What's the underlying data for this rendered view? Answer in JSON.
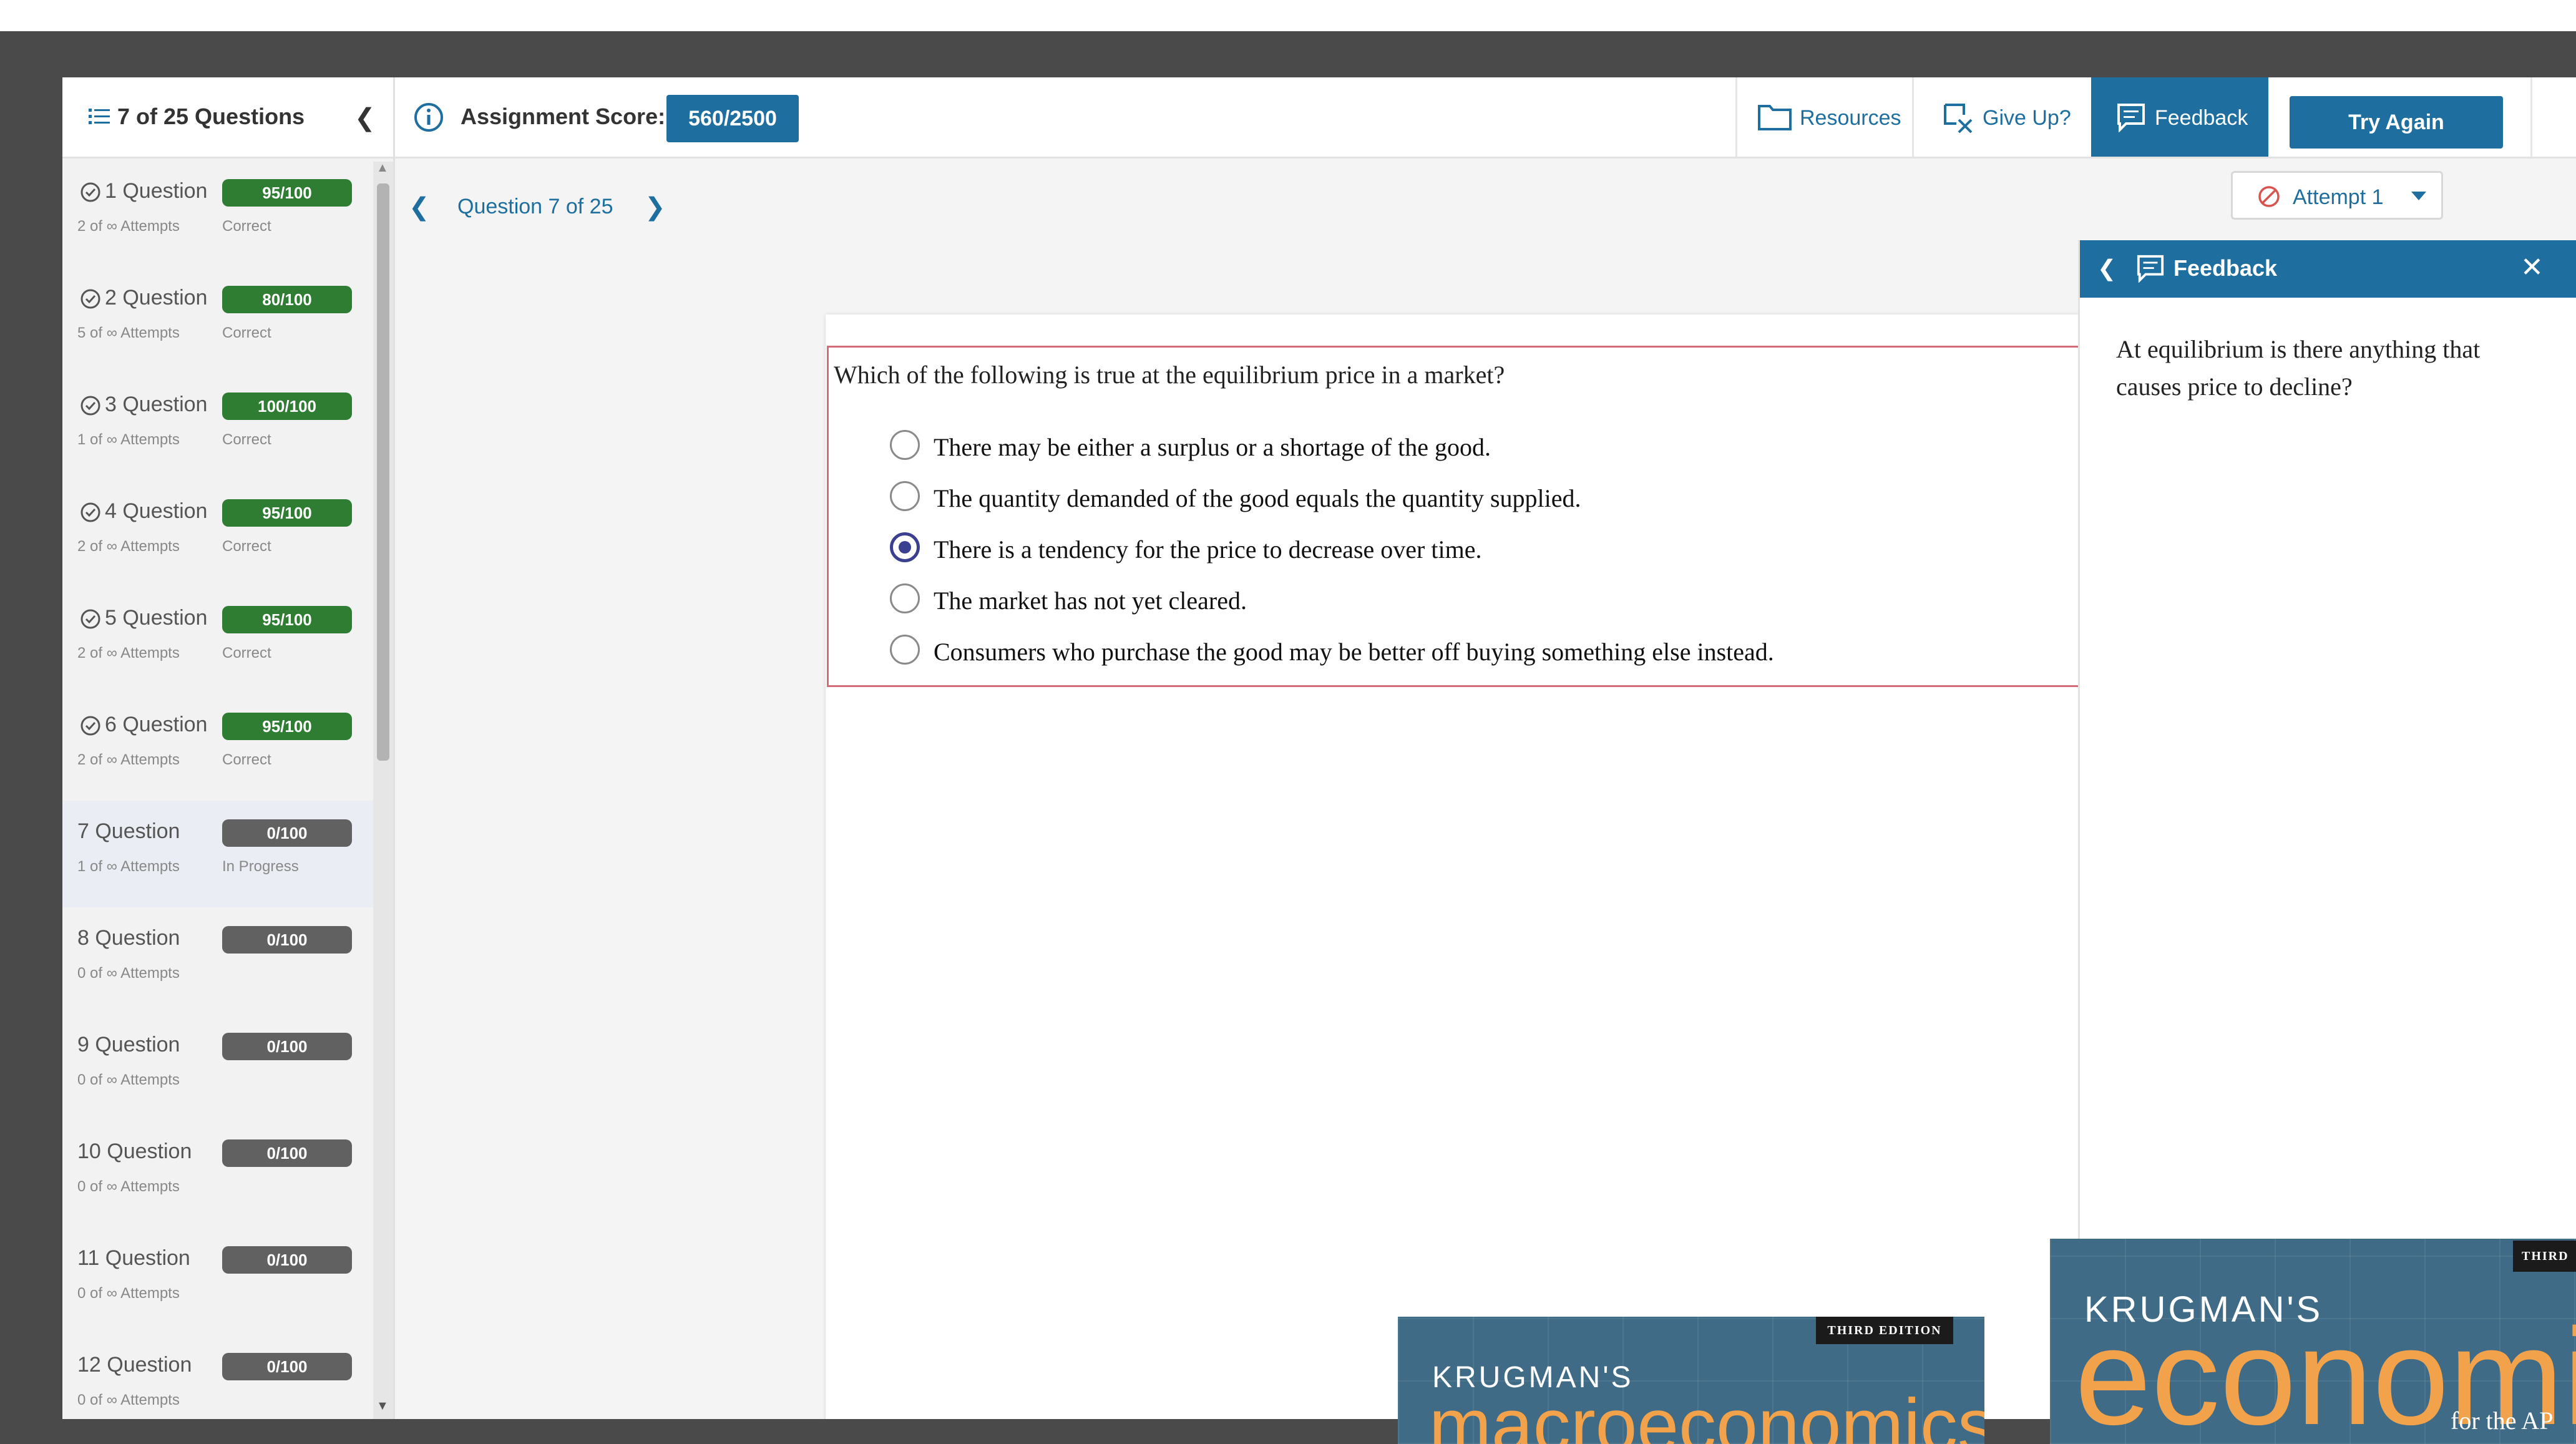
{
  "sidebar": {
    "title": "7 of 25 Questions",
    "items": [
      {
        "label": "1 Question",
        "attempts": "2 of ∞ Attempts",
        "status": "Correct",
        "score": "95/100",
        "answered": true
      },
      {
        "label": "2 Question",
        "attempts": "5 of ∞ Attempts",
        "status": "Correct",
        "score": "80/100",
        "answered": true
      },
      {
        "label": "3 Question",
        "attempts": "1 of ∞ Attempts",
        "status": "Correct",
        "score": "100/100",
        "answered": true
      },
      {
        "label": "4 Question",
        "attempts": "2 of ∞ Attempts",
        "status": "Correct",
        "score": "95/100",
        "answered": true
      },
      {
        "label": "5 Question",
        "attempts": "2 of ∞ Attempts",
        "status": "Correct",
        "score": "95/100",
        "answered": true
      },
      {
        "label": "6 Question",
        "attempts": "2 of ∞ Attempts",
        "status": "Correct",
        "score": "95/100",
        "answered": true
      },
      {
        "label": "7 Question",
        "attempts": "1 of ∞ Attempts",
        "status": "In Progress",
        "score": "0/100",
        "answered": false
      },
      {
        "label": "8 Question",
        "attempts": "0 of ∞ Attempts",
        "status": "",
        "score": "0/100",
        "answered": false
      },
      {
        "label": "9 Question",
        "attempts": "0 of ∞ Attempts",
        "status": "",
        "score": "0/100",
        "answered": false
      },
      {
        "label": "10 Question",
        "attempts": "0 of ∞ Attempts",
        "status": "",
        "score": "0/100",
        "answered": false
      },
      {
        "label": "11 Question",
        "attempts": "0 of ∞ Attempts",
        "status": "",
        "score": "0/100",
        "answered": false
      },
      {
        "label": "12 Question",
        "attempts": "0 of ∞ Attempts",
        "status": "",
        "score": "0/100",
        "answered": false
      }
    ]
  },
  "topbar": {
    "score_label": "Assignment Score:",
    "score_value": "560/2500",
    "resources_label": "Resources",
    "giveup_label": "Give Up?",
    "feedback_label": "Feedback",
    "tryagain_label": "Try Again"
  },
  "question_nav": {
    "label": "Question 7 of 25"
  },
  "attempt": {
    "label": "Attempt 1"
  },
  "question": {
    "prompt": "Which of the following is true at the equilibrium price in a market?",
    "options": [
      {
        "text": "There may be either a surplus or a shortage of the good.",
        "selected": false
      },
      {
        "text": "The quantity demanded of the good equals the quantity supplied.",
        "selected": false
      },
      {
        "text": "There is a tendency for the price to decrease over time.",
        "selected": true
      },
      {
        "text": "The market has not yet cleared.",
        "selected": false
      },
      {
        "text": "Consumers who purchase the good may be better off buying something else instead.",
        "selected": false
      }
    ]
  },
  "feedback_panel": {
    "title": "Feedback",
    "text": "At equilibrium is there anything that causes price to decline?"
  },
  "books": [
    {
      "edition": "THIRD EDITION",
      "author": "KRUGMAN'S",
      "title": "macroeconomics"
    },
    {
      "edition": "THIRD",
      "author": "KRUGMAN'S",
      "title": "economi",
      "subtitle": "for the AP"
    }
  ],
  "colors": {
    "accent": "#1e6f9f",
    "score_green": "#2e7d32",
    "score_gray": "#616161",
    "question_border": "#d86a7a",
    "radio_selected": "#3a3f8f"
  }
}
